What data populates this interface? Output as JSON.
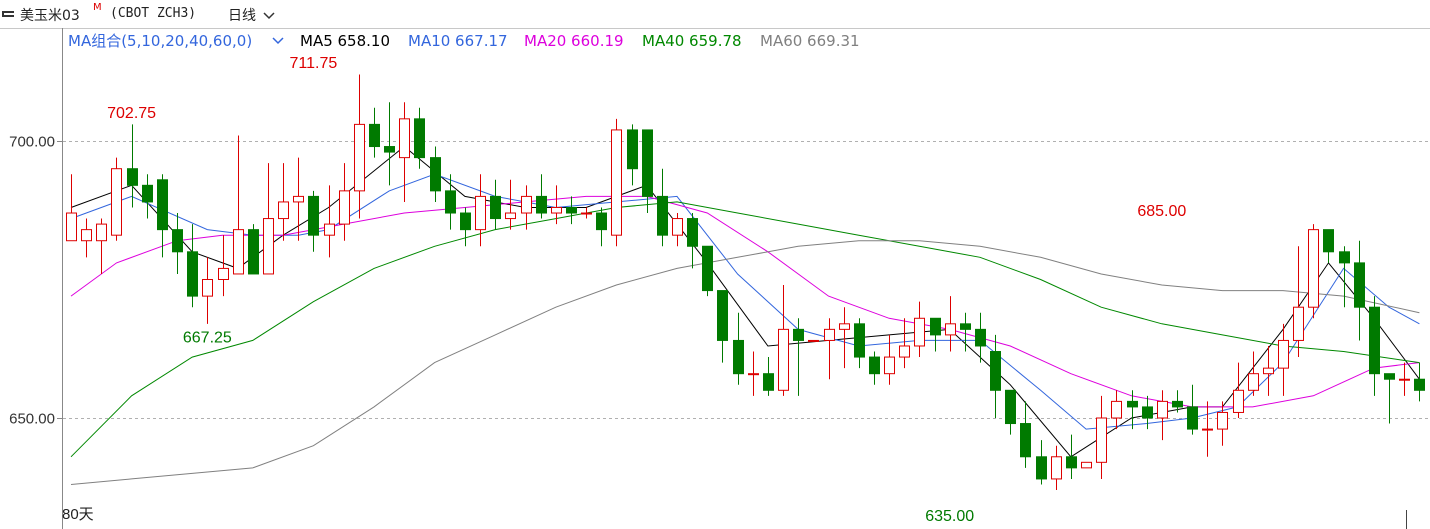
{
  "header": {
    "name": "美玉米03",
    "badge": "M",
    "code": "(CBOT ZCH3)",
    "period": "日线"
  },
  "legend": {
    "group_label": "MA组合(5,10,20,40,60,0)",
    "items": [
      {
        "key": "ma5",
        "name": "MA5",
        "value": "658.10",
        "color": "#000000"
      },
      {
        "key": "ma10",
        "name": "MA10",
        "value": "667.17",
        "color": "#3366dd"
      },
      {
        "key": "ma20",
        "name": "MA20",
        "value": "660.19",
        "color": "#dd00dd"
      },
      {
        "key": "ma40",
        "name": "MA40",
        "value": "659.78",
        "color": "#008800"
      },
      {
        "key": "ma60",
        "name": "MA60",
        "value": "669.31",
        "color": "#808080"
      }
    ]
  },
  "colors": {
    "up": "#dd0000",
    "down": "#007a00",
    "grid": "#b0b0b0",
    "axis": "#888888"
  },
  "days_label": "80天",
  "chart_data": {
    "type": "candlestick",
    "ylim": [
      633,
      712
    ],
    "yticks": [
      {
        "value": 650,
        "label": "650.00"
      },
      {
        "value": 700,
        "label": "700.00"
      }
    ],
    "annotations": [
      {
        "index": 4,
        "value": 702.75,
        "label": "702.75",
        "pos": "above",
        "color": "#dd0000"
      },
      {
        "index": 16,
        "value": 711.75,
        "label": "711.75",
        "pos": "above",
        "color": "#dd0000"
      },
      {
        "index": 9,
        "value": 667.25,
        "label": "667.25",
        "pos": "below",
        "color": "#007a00"
      },
      {
        "index": 58,
        "value": 635.0,
        "label": "635.00",
        "pos": "below",
        "color": "#007a00"
      },
      {
        "index": 72,
        "value": 685.0,
        "label": "685.00",
        "pos": "above",
        "color": "#dd0000"
      }
    ],
    "candles": [
      [
        682,
        687,
        682,
        694
      ],
      [
        682,
        684,
        679,
        686
      ],
      [
        682,
        685,
        676,
        686
      ],
      [
        683,
        695,
        682,
        697
      ],
      [
        695,
        692,
        688,
        703
      ],
      [
        692,
        689,
        686,
        694
      ],
      [
        693,
        684,
        679,
        694
      ],
      [
        684,
        680,
        676,
        687
      ],
      [
        680,
        672,
        670,
        685
      ],
      [
        672,
        675,
        667,
        679
      ],
      [
        675,
        677,
        672,
        683
      ],
      [
        676,
        684,
        676,
        701
      ],
      [
        684,
        676,
        676,
        685
      ],
      [
        676,
        686,
        676,
        696
      ],
      [
        686,
        689,
        682,
        696
      ],
      [
        689,
        690,
        682,
        697
      ],
      [
        690,
        683,
        680,
        691
      ],
      [
        683,
        685,
        679,
        692
      ],
      [
        685,
        691,
        682,
        696
      ],
      [
        691,
        703,
        686,
        712
      ],
      [
        703,
        699,
        697,
        706
      ],
      [
        699,
        698,
        692,
        707
      ],
      [
        697,
        704,
        689,
        707
      ],
      [
        704,
        697,
        695,
        706
      ],
      [
        697,
        691,
        689,
        699
      ],
      [
        691,
        687,
        684,
        694
      ],
      [
        687,
        684,
        681,
        688
      ],
      [
        684,
        690,
        681,
        694
      ],
      [
        690,
        686,
        684,
        693
      ],
      [
        686,
        687,
        684,
        693
      ],
      [
        687,
        690,
        684,
        692
      ],
      [
        690,
        687,
        686,
        694
      ],
      [
        687,
        688,
        685,
        692
      ],
      [
        688,
        687,
        685,
        690
      ],
      [
        687,
        687,
        686,
        688
      ],
      [
        687,
        684,
        681,
        688
      ],
      [
        683,
        702,
        681,
        704
      ],
      [
        702,
        695,
        692,
        703
      ],
      [
        702,
        690,
        687,
        702
      ],
      [
        690,
        683,
        681,
        695
      ],
      [
        683,
        686,
        681,
        687
      ],
      [
        686,
        681,
        677,
        687
      ],
      [
        681,
        673,
        672,
        681
      ],
      [
        673,
        664,
        660,
        673
      ],
      [
        664,
        658,
        656,
        669
      ],
      [
        658,
        658,
        654,
        662
      ],
      [
        658,
        655,
        654,
        661
      ],
      [
        655,
        666,
        654,
        674
      ],
      [
        666,
        664,
        654,
        668
      ],
      [
        664,
        664,
        664,
        664
      ],
      [
        664,
        666,
        657,
        668
      ],
      [
        666,
        667,
        659,
        670
      ],
      [
        667,
        661,
        659,
        668
      ],
      [
        661,
        658,
        656,
        662
      ],
      [
        658,
        661,
        656,
        665
      ],
      [
        661,
        663,
        659,
        668
      ],
      [
        663,
        668,
        661,
        671
      ],
      [
        668,
        665,
        662,
        668
      ],
      [
        665,
        667,
        662,
        672
      ],
      [
        667,
        666,
        662,
        669
      ],
      [
        666,
        663,
        660,
        669
      ],
      [
        662,
        655,
        650,
        665
      ],
      [
        655,
        649,
        647,
        655
      ],
      [
        649,
        643,
        641,
        653
      ],
      [
        643,
        639,
        638,
        646
      ],
      [
        639,
        643,
        637,
        645
      ],
      [
        643,
        641,
        639,
        647
      ],
      [
        641,
        642,
        641,
        642
      ],
      [
        642,
        650,
        639,
        654
      ],
      [
        650,
        653,
        648,
        655
      ],
      [
        653,
        652,
        648,
        655
      ],
      [
        652,
        650,
        648,
        654
      ],
      [
        650,
        653,
        646,
        655
      ],
      [
        653,
        652,
        651,
        655
      ],
      [
        652,
        648,
        647,
        656
      ],
      [
        648,
        648,
        643,
        653
      ],
      [
        648,
        651,
        645,
        653
      ],
      [
        651,
        655,
        650,
        660
      ],
      [
        655,
        658,
        654,
        662
      ],
      [
        658,
        659,
        654,
        663
      ],
      [
        659,
        664,
        654,
        667
      ],
      [
        664,
        670,
        661,
        681
      ],
      [
        670,
        684,
        668,
        685
      ],
      [
        684,
        680,
        678,
        682
      ],
      [
        680,
        678,
        670,
        681
      ],
      [
        678,
        670,
        664,
        682
      ],
      [
        670,
        658,
        654,
        672
      ],
      [
        658,
        657,
        649,
        658
      ],
      [
        657,
        657,
        654,
        660
      ],
      [
        657,
        655,
        653,
        660
      ],
      [
        656,
        660,
        654,
        661
      ]
    ],
    "series": [
      {
        "key": "ma5",
        "values": [
          [
            0,
            688
          ],
          [
            4,
            692
          ],
          [
            8,
            680
          ],
          [
            11,
            677
          ],
          [
            14,
            683
          ],
          [
            17,
            688
          ],
          [
            22,
            699
          ],
          [
            26,
            690
          ],
          [
            30,
            688
          ],
          [
            34,
            688
          ],
          [
            38,
            692
          ],
          [
            42,
            678
          ],
          [
            46,
            663
          ],
          [
            50,
            664
          ],
          [
            54,
            665
          ],
          [
            58,
            666
          ],
          [
            62,
            656
          ],
          [
            66,
            643
          ],
          [
            70,
            650
          ],
          [
            74,
            652
          ],
          [
            76,
            652
          ],
          [
            80,
            666
          ],
          [
            83,
            678
          ],
          [
            86,
            668
          ],
          [
            89,
            657
          ]
        ]
      },
      {
        "key": "ma10",
        "values": [
          [
            0,
            686
          ],
          [
            4,
            690
          ],
          [
            9,
            684
          ],
          [
            12,
            683
          ],
          [
            15,
            683
          ],
          [
            17,
            684
          ],
          [
            21,
            691
          ],
          [
            24,
            694
          ],
          [
            28,
            690
          ],
          [
            32,
            688
          ],
          [
            36,
            689
          ],
          [
            40,
            690
          ],
          [
            44,
            676
          ],
          [
            48,
            666
          ],
          [
            52,
            663
          ],
          [
            56,
            664
          ],
          [
            60,
            664
          ],
          [
            64,
            655
          ],
          [
            67,
            648
          ],
          [
            71,
            649
          ],
          [
            74,
            650
          ],
          [
            77,
            652
          ],
          [
            80,
            660
          ],
          [
            84,
            677
          ],
          [
            87,
            670
          ],
          [
            89,
            667
          ]
        ]
      },
      {
        "key": "ma20",
        "values": [
          [
            0,
            672
          ],
          [
            3,
            678
          ],
          [
            7,
            682
          ],
          [
            10,
            683
          ],
          [
            14,
            683
          ],
          [
            18,
            685
          ],
          [
            22,
            687
          ],
          [
            26,
            688
          ],
          [
            30,
            689
          ],
          [
            34,
            690
          ],
          [
            38,
            690
          ],
          [
            42,
            687
          ],
          [
            46,
            680
          ],
          [
            50,
            672
          ],
          [
            54,
            668
          ],
          [
            58,
            666
          ],
          [
            62,
            663
          ],
          [
            66,
            658
          ],
          [
            70,
            654
          ],
          [
            74,
            652
          ],
          [
            78,
            652
          ],
          [
            82,
            654
          ],
          [
            86,
            659
          ],
          [
            89,
            660
          ]
        ]
      },
      {
        "key": "ma40",
        "values": [
          [
            0,
            643
          ],
          [
            4,
            654
          ],
          [
            8,
            661
          ],
          [
            12,
            664
          ],
          [
            16,
            671
          ],
          [
            20,
            677
          ],
          [
            24,
            681
          ],
          [
            28,
            684
          ],
          [
            32,
            686
          ],
          [
            36,
            688
          ],
          [
            40,
            689
          ],
          [
            44,
            687
          ],
          [
            48,
            685
          ],
          [
            52,
            683
          ],
          [
            56,
            681
          ],
          [
            60,
            679
          ],
          [
            64,
            675
          ],
          [
            68,
            670
          ],
          [
            72,
            667
          ],
          [
            76,
            665
          ],
          [
            80,
            663
          ],
          [
            84,
            662
          ],
          [
            89,
            660
          ]
        ]
      },
      {
        "key": "ma60",
        "values": [
          [
            0,
            638
          ],
          [
            4,
            639
          ],
          [
            8,
            640
          ],
          [
            12,
            641
          ],
          [
            16,
            645
          ],
          [
            20,
            652
          ],
          [
            24,
            660
          ],
          [
            28,
            665
          ],
          [
            32,
            670
          ],
          [
            36,
            674
          ],
          [
            40,
            677
          ],
          [
            44,
            679
          ],
          [
            48,
            681
          ],
          [
            52,
            682
          ],
          [
            56,
            682
          ],
          [
            60,
            681
          ],
          [
            64,
            679
          ],
          [
            68,
            676
          ],
          [
            72,
            674
          ],
          [
            76,
            673
          ],
          [
            80,
            673
          ],
          [
            84,
            672
          ],
          [
            89,
            669
          ]
        ]
      }
    ]
  }
}
